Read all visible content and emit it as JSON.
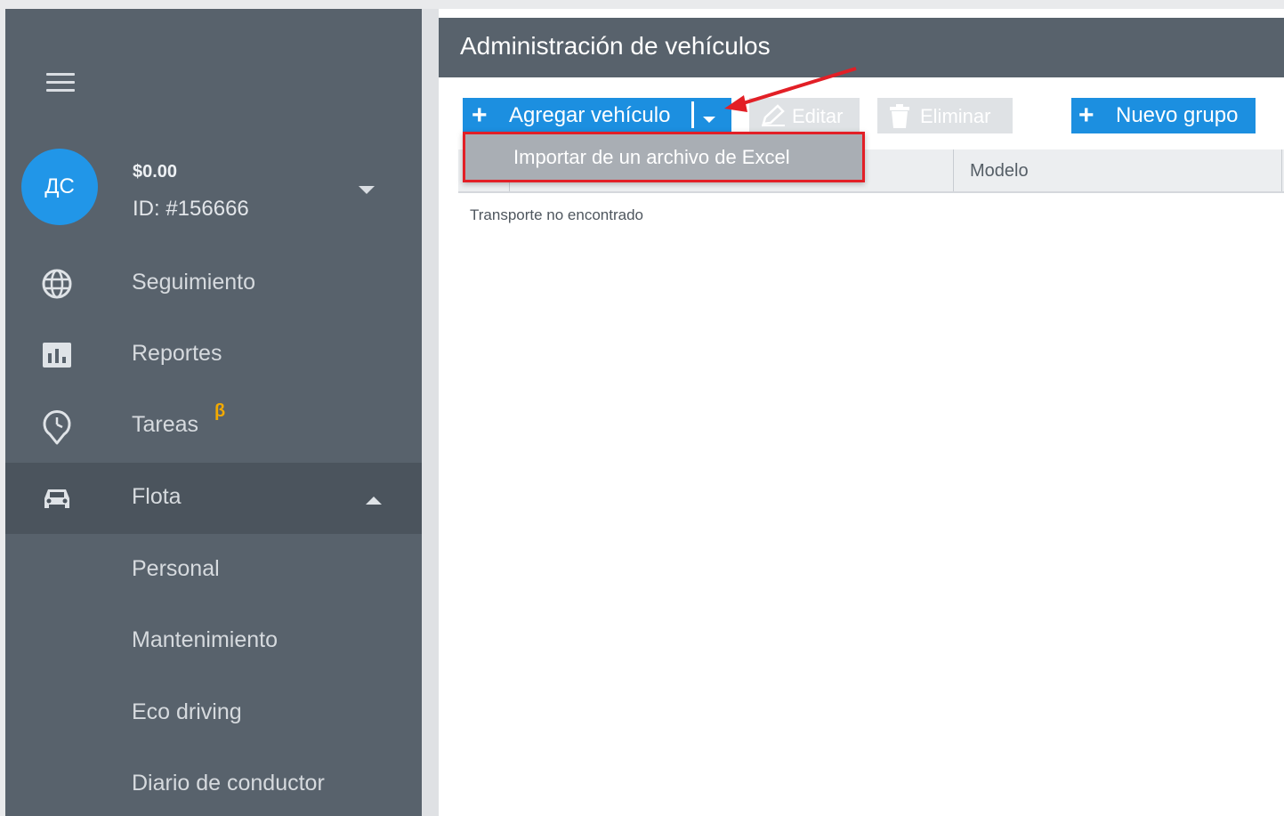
{
  "sidebar": {
    "avatar_initials": "ДС",
    "balance": "$0.00",
    "user_id": "ID: #156666",
    "items": [
      {
        "label": "Seguimiento",
        "icon": "globe-icon"
      },
      {
        "label": "Reportes",
        "icon": "bar-chart-icon"
      },
      {
        "label": "Tareas",
        "icon": "location-clock-icon",
        "badge": "β"
      },
      {
        "label": "Flota",
        "icon": "car-icon",
        "expanded": true
      }
    ],
    "sub_items": [
      "Personal",
      "Mantenimiento",
      "Eco driving",
      "Diario de conductor"
    ]
  },
  "main": {
    "title": "Administración de vehículos",
    "toolbar": {
      "add_label": "Agregar vehículo",
      "edit_label": "Editar",
      "delete_label": "Eliminar",
      "new_group_label": "Nuevo grupo"
    },
    "dropdown_item": "Importar de un archivo de Excel",
    "table": {
      "columns": [
        "",
        "",
        "Modelo"
      ],
      "empty_message": "Transporte no encontrado"
    }
  },
  "colors": {
    "sidebar_bg": "#58626c",
    "accent_blue": "#1c8fe0",
    "highlight_red": "#e21f26",
    "beta_badge": "#f2a900"
  }
}
